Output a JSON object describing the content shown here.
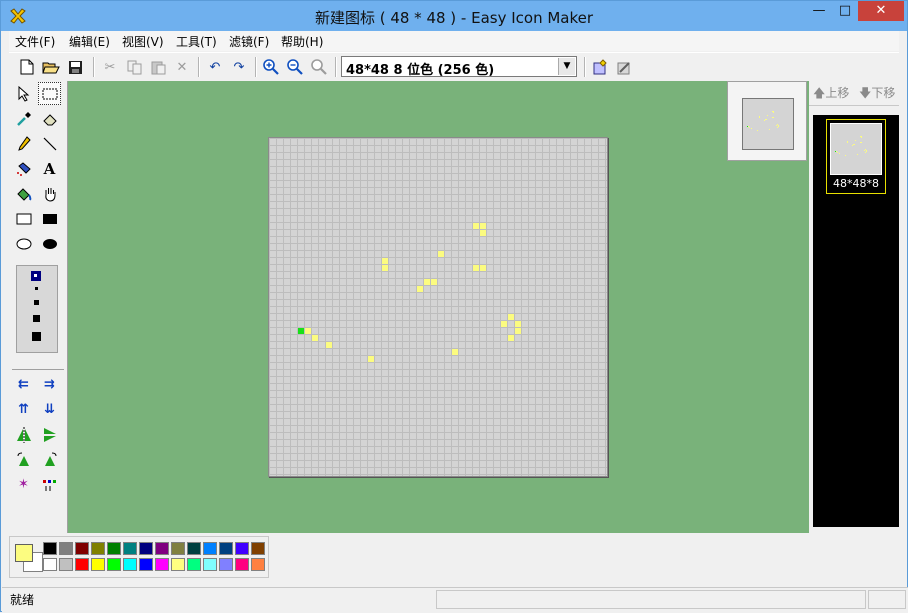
{
  "window": {
    "title": "新建图标 ( 48 * 48 )  - Easy Icon Maker",
    "minimize_glyph": "—",
    "maximize_glyph": "□",
    "close_glyph": "✕"
  },
  "menu": [
    {
      "label": "文件(F)"
    },
    {
      "label": "编辑(E)"
    },
    {
      "label": "视图(V)"
    },
    {
      "label": "工具(T)"
    },
    {
      "label": "滤镜(F)"
    },
    {
      "label": "帮助(H)"
    }
  ],
  "toolbar": {
    "format_select": "48*48  8 位色 (256 色)"
  },
  "icons": {
    "new": "new-file-icon",
    "open": "open-folder-icon",
    "save": "save-icon",
    "cut": "cut-icon",
    "copy": "copy-icon",
    "paste": "paste-icon",
    "delete": "delete-icon",
    "undo": "undo-icon",
    "redo": "redo-icon",
    "zoom_in": "zoom-in-icon",
    "zoom_out": "zoom-out-icon",
    "zoom_reset": "zoom-reset-icon",
    "add_format": "add-format-icon",
    "edit_format": "edit-format-icon"
  },
  "tools": [
    "select-arrow-icon",
    "select-rect-icon",
    "eyedropper-icon",
    "eraser-icon",
    "pencil-icon",
    "line-icon",
    "spray-icon",
    "text-icon",
    "fill-bucket-icon",
    "hand-icon",
    "rect-outline-icon",
    "rect-filled-icon",
    "ellipse-outline-icon",
    "ellipse-filled-icon"
  ],
  "tools_text": {
    "text_tool": "A"
  },
  "transform_tools": [
    "shift-left-icon",
    "shift-right-icon",
    "shift-up-icon",
    "shift-down-icon",
    "flip-horizontal-icon",
    "flip-vertical-icon",
    "rotate-left-icon",
    "rotate-right-icon",
    "special-effect-icon",
    "color-replace-icon"
  ],
  "canvas": {
    "size": 48,
    "primary_pixel_color": "#fcfc80",
    "accent_pixel_color": "#18e018",
    "pixels": [
      [
        29,
        12
      ],
      [
        30,
        12
      ],
      [
        30,
        13
      ],
      [
        24,
        16
      ],
      [
        16,
        17
      ],
      [
        16,
        18
      ],
      [
        29,
        18
      ],
      [
        30,
        18
      ],
      [
        22,
        20
      ],
      [
        23,
        20
      ],
      [
        21,
        21
      ],
      [
        34,
        25
      ],
      [
        33,
        26
      ],
      [
        35,
        26
      ],
      [
        35,
        27
      ],
      [
        5,
        27
      ],
      [
        34,
        28
      ],
      [
        6,
        28
      ],
      [
        8,
        29
      ],
      [
        14,
        31
      ],
      [
        26,
        30
      ]
    ],
    "accent_pixels": [
      [
        4,
        27
      ]
    ]
  },
  "right_panel": {
    "move_up": "上移",
    "move_down": "下移",
    "icon_label": "48*48*8"
  },
  "palette": {
    "foreground": "#fcfc80",
    "background": "#ffffff",
    "row1": [
      "#000000",
      "#808080",
      "#800000",
      "#808000",
      "#008000",
      "#008080",
      "#000080",
      "#800080",
      "#808040",
      "#004040",
      "#0080ff",
      "#004080",
      "#4000ff",
      "#804000"
    ],
    "row2": [
      "#ffffff",
      "#c0c0c0",
      "#ff0000",
      "#ffff00",
      "#00ff00",
      "#00ffff",
      "#0000ff",
      "#ff00ff",
      "#ffff80",
      "#00ff80",
      "#80ffff",
      "#8080ff",
      "#ff0080",
      "#ff8040"
    ]
  },
  "status": {
    "text": "就绪"
  }
}
